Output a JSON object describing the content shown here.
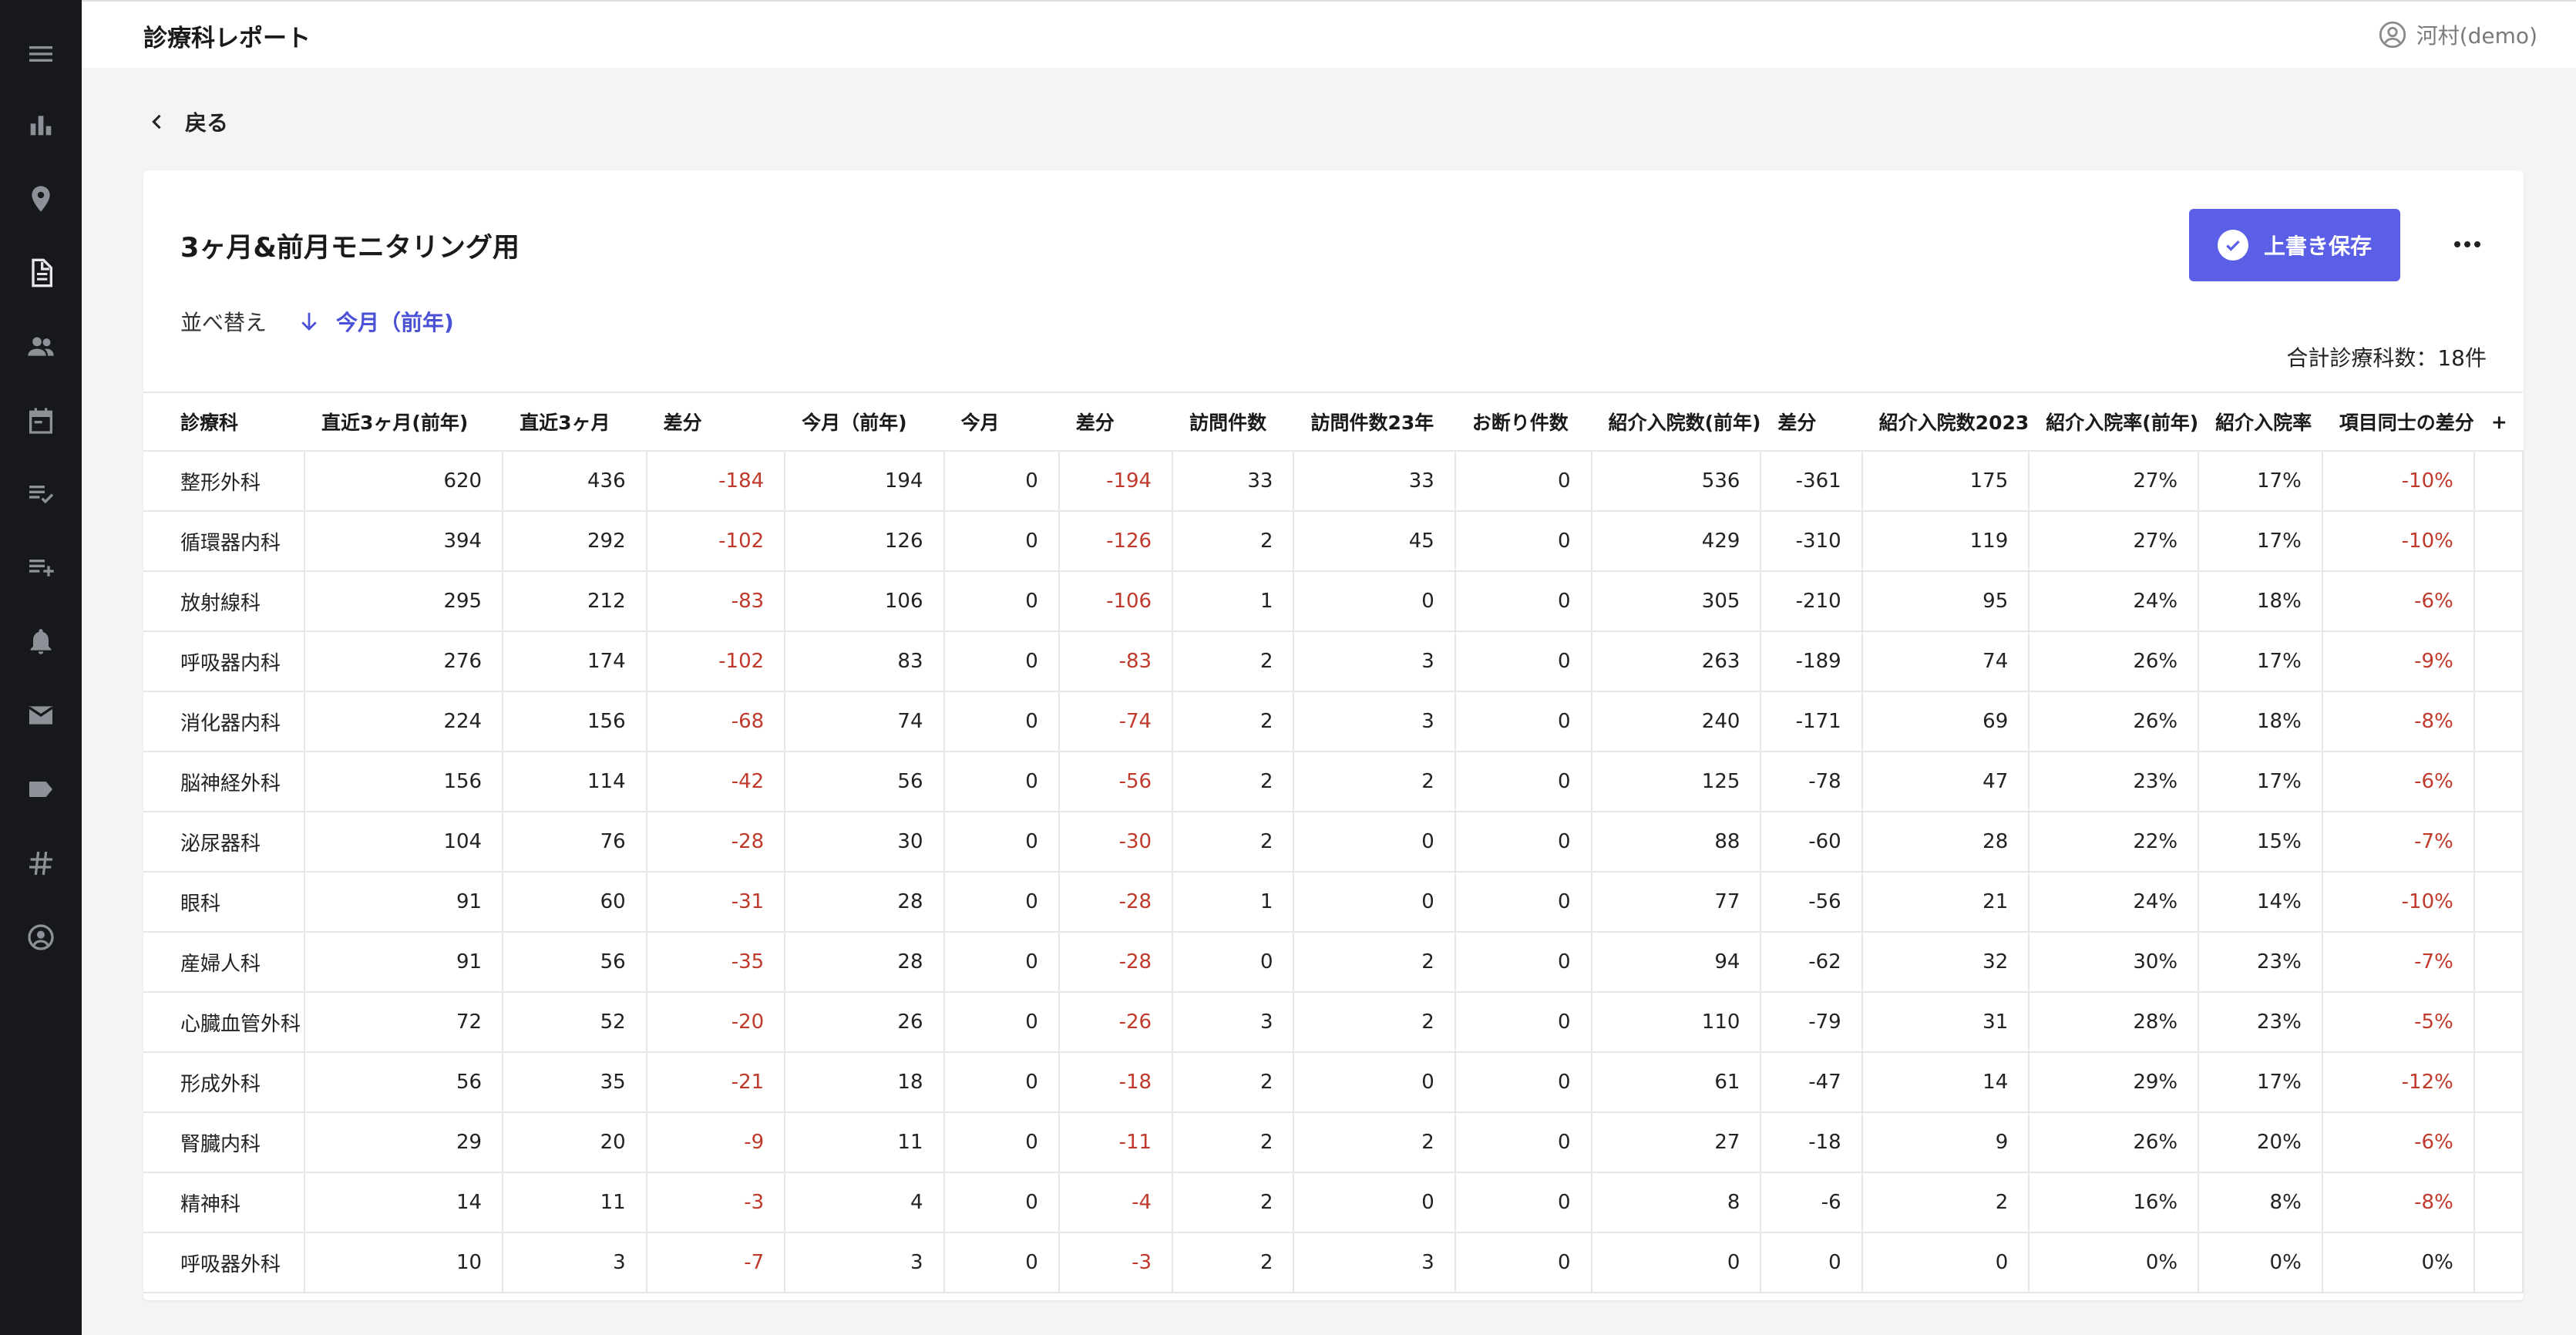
{
  "app": {
    "page_title": "診療科レポート",
    "user_name": "河村(demo)"
  },
  "sidebar": {
    "items": [
      {
        "icon": "menu-icon"
      },
      {
        "icon": "bar-chart-icon"
      },
      {
        "icon": "location-pin-icon"
      },
      {
        "icon": "document-icon",
        "active": true
      },
      {
        "icon": "people-icon"
      },
      {
        "icon": "calendar-icon"
      },
      {
        "icon": "checklist-icon"
      },
      {
        "icon": "playlist-add-icon"
      },
      {
        "icon": "bell-icon"
      },
      {
        "icon": "mail-icon"
      },
      {
        "icon": "tag-icon"
      },
      {
        "icon": "hashtag-icon"
      },
      {
        "icon": "account-circle-icon"
      }
    ]
  },
  "nav": {
    "back_label": "戻る"
  },
  "report": {
    "title": "3ヶ月&前月モニタリング用",
    "save_label": "上書き保存",
    "sort_label": "並べ替え",
    "sort_value": "今月（前年)",
    "total_label": "合計診療科数：18件"
  },
  "colors": {
    "accent": "#5a5fe6",
    "negative": "#c0392b",
    "sidebar_bg": "#16181c"
  },
  "table": {
    "headers": [
      "診療科",
      "直近3ヶ月(前年)",
      "直近3ヶ月",
      "差分",
      "今月（前年)",
      "今月",
      "差分",
      "訪問件数",
      "訪問件数23年",
      "お断り件数",
      "紹介入院数(前年)",
      "差分",
      "紹介入院数2023",
      "紹介入院率(前年)",
      "紹介入院率",
      "項目同士の差分"
    ],
    "negative_columns": [
      3,
      6,
      10,
      15
    ],
    "rows": [
      [
        "整形外科",
        "620",
        "436",
        "-184",
        "194",
        "0",
        "-194",
        "33",
        "33",
        "0",
        "536",
        "-361",
        "175",
        "27%",
        "17%",
        "-10%"
      ],
      [
        "循環器内科",
        "394",
        "292",
        "-102",
        "126",
        "0",
        "-126",
        "2",
        "45",
        "0",
        "429",
        "-310",
        "119",
        "27%",
        "17%",
        "-10%"
      ],
      [
        "放射線科",
        "295",
        "212",
        "-83",
        "106",
        "0",
        "-106",
        "1",
        "0",
        "0",
        "305",
        "-210",
        "95",
        "24%",
        "18%",
        "-6%"
      ],
      [
        "呼吸器内科",
        "276",
        "174",
        "-102",
        "83",
        "0",
        "-83",
        "2",
        "3",
        "0",
        "263",
        "-189",
        "74",
        "26%",
        "17%",
        "-9%"
      ],
      [
        "消化器内科",
        "224",
        "156",
        "-68",
        "74",
        "0",
        "-74",
        "2",
        "3",
        "0",
        "240",
        "-171",
        "69",
        "26%",
        "18%",
        "-8%"
      ],
      [
        "脳神経外科",
        "156",
        "114",
        "-42",
        "56",
        "0",
        "-56",
        "2",
        "2",
        "0",
        "125",
        "-78",
        "47",
        "23%",
        "17%",
        "-6%"
      ],
      [
        "泌尿器科",
        "104",
        "76",
        "-28",
        "30",
        "0",
        "-30",
        "2",
        "0",
        "0",
        "88",
        "-60",
        "28",
        "22%",
        "15%",
        "-7%"
      ],
      [
        "眼科",
        "91",
        "60",
        "-31",
        "28",
        "0",
        "-28",
        "1",
        "0",
        "0",
        "77",
        "-56",
        "21",
        "24%",
        "14%",
        "-10%"
      ],
      [
        "産婦人科",
        "91",
        "56",
        "-35",
        "28",
        "0",
        "-28",
        "0",
        "2",
        "0",
        "94",
        "-62",
        "32",
        "30%",
        "23%",
        "-7%"
      ],
      [
        "心臓血管外科",
        "72",
        "52",
        "-20",
        "26",
        "0",
        "-26",
        "3",
        "2",
        "0",
        "110",
        "-79",
        "31",
        "28%",
        "23%",
        "-5%"
      ],
      [
        "形成外科",
        "56",
        "35",
        "-21",
        "18",
        "0",
        "-18",
        "2",
        "0",
        "0",
        "61",
        "-47",
        "14",
        "29%",
        "17%",
        "-12%"
      ],
      [
        "腎臓内科",
        "29",
        "20",
        "-9",
        "11",
        "0",
        "-11",
        "2",
        "2",
        "0",
        "27",
        "-18",
        "9",
        "26%",
        "20%",
        "-6%"
      ],
      [
        "精神科",
        "14",
        "11",
        "-3",
        "4",
        "0",
        "-4",
        "2",
        "0",
        "0",
        "8",
        "-6",
        "2",
        "16%",
        "8%",
        "-8%"
      ],
      [
        "呼吸器外科",
        "10",
        "3",
        "-7",
        "3",
        "0",
        "-3",
        "2",
        "3",
        "0",
        "0",
        "0",
        "0",
        "0%",
        "0%",
        "0%"
      ]
    ]
  }
}
